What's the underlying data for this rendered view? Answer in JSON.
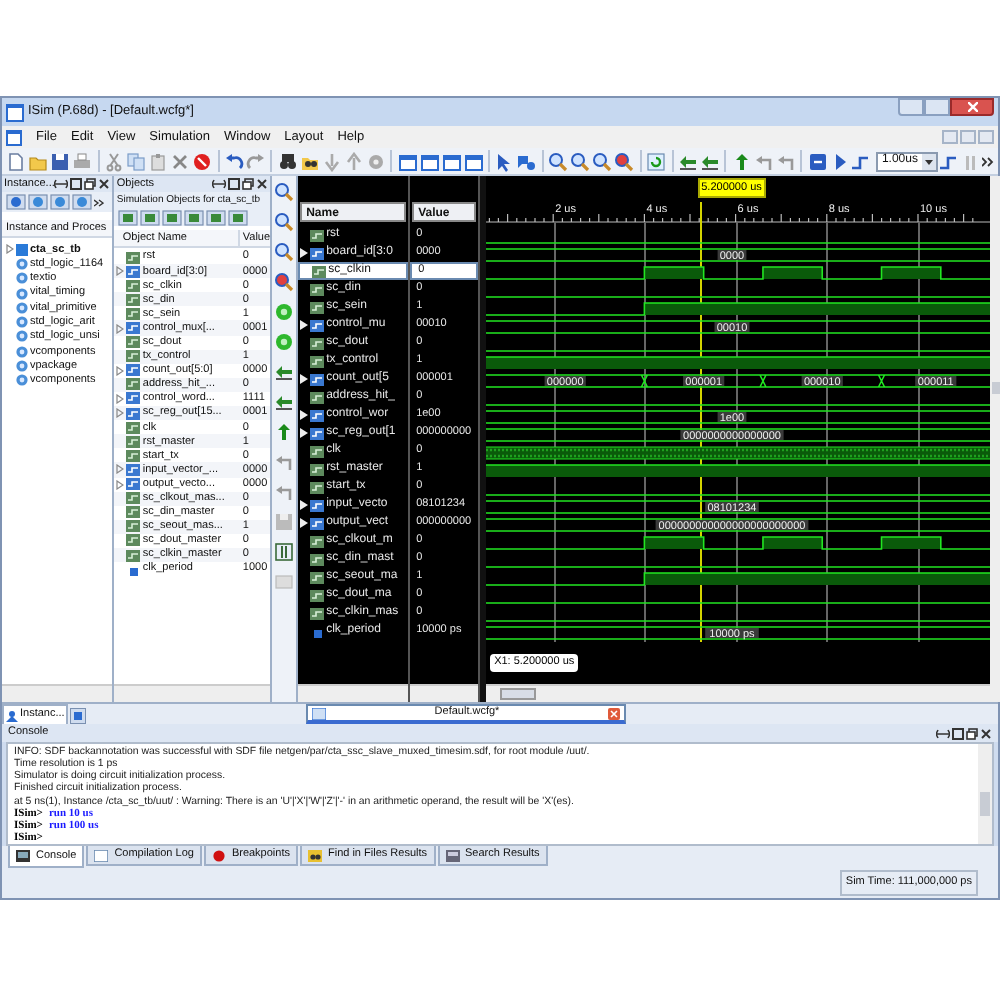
{
  "window": {
    "title": "ISim (P.68d) - [Default.wcfg*]"
  },
  "menu": [
    "File",
    "Edit",
    "View",
    "Simulation",
    "Window",
    "Layout",
    "Help"
  ],
  "toolbar": {
    "zoom_time": "1.00us"
  },
  "instances_panel": {
    "title": "Instance...",
    "column": "Instance and Proces",
    "items": [
      {
        "label": "cta_sc_tb",
        "kind": "module"
      },
      {
        "label": "std_logic_1164",
        "kind": "package"
      },
      {
        "label": "textio",
        "kind": "package"
      },
      {
        "label": "vital_timing",
        "kind": "package"
      },
      {
        "label": "vital_primitive",
        "kind": "package"
      },
      {
        "label": "std_logic_arit",
        "kind": "package"
      },
      {
        "label": "std_logic_unsi",
        "kind": "package"
      },
      {
        "label": "vcomponents",
        "kind": "package"
      },
      {
        "label": "vpackage",
        "kind": "package"
      },
      {
        "label": "vcomponents",
        "kind": "package"
      }
    ]
  },
  "objects_panel": {
    "title": "Objects",
    "subtitle": "Simulation Objects for cta_sc_tb",
    "columns": [
      "Object Name",
      "Value"
    ],
    "rows": [
      {
        "name": "rst",
        "value": "0",
        "kind": "bit"
      },
      {
        "name": "board_id[3:0]",
        "value": "0000",
        "kind": "bus"
      },
      {
        "name": "sc_clkin",
        "value": "0",
        "kind": "bit"
      },
      {
        "name": "sc_din",
        "value": "0",
        "kind": "bit"
      },
      {
        "name": "sc_sein",
        "value": "1",
        "kind": "bit"
      },
      {
        "name": "control_mux[...",
        "value": "0001",
        "kind": "bus"
      },
      {
        "name": "sc_dout",
        "value": "0",
        "kind": "bit"
      },
      {
        "name": "tx_control",
        "value": "1",
        "kind": "bit"
      },
      {
        "name": "count_out[5:0]",
        "value": "0000",
        "kind": "bus"
      },
      {
        "name": "address_hit_...",
        "value": "0",
        "kind": "bit"
      },
      {
        "name": "control_word...",
        "value": "1111",
        "kind": "bus"
      },
      {
        "name": "sc_reg_out[15...",
        "value": "0001",
        "kind": "bus"
      },
      {
        "name": "clk",
        "value": "0",
        "kind": "bit"
      },
      {
        "name": "rst_master",
        "value": "1",
        "kind": "bit"
      },
      {
        "name": "start_tx",
        "value": "0",
        "kind": "bit"
      },
      {
        "name": "input_vector_...",
        "value": "0000",
        "kind": "bus"
      },
      {
        "name": "output_vecto...",
        "value": "0000",
        "kind": "bus"
      },
      {
        "name": "sc_clkout_mas...",
        "value": "0",
        "kind": "bit"
      },
      {
        "name": "sc_din_master",
        "value": "0",
        "kind": "bit"
      },
      {
        "name": "sc_seout_mas...",
        "value": "1",
        "kind": "bit"
      },
      {
        "name": "sc_dout_master",
        "value": "0",
        "kind": "bit"
      },
      {
        "name": "sc_clkin_master",
        "value": "0",
        "kind": "bit"
      },
      {
        "name": "clk_period",
        "value": "1000",
        "kind": "const"
      }
    ]
  },
  "wave": {
    "columns": [
      "Name",
      "Value"
    ],
    "cursor_time": "5.200000 us",
    "cursor_readout": "X1: 5.200000 us",
    "time_ticks": [
      "2 us",
      "4 us",
      "6 us",
      "8 us",
      "10 us"
    ],
    "signals": [
      {
        "name": "rst",
        "value": "0",
        "kind": "bit",
        "selected": false,
        "wave": {
          "kind": "low"
        }
      },
      {
        "name": "board_id[3:0",
        "value": "0000",
        "kind": "bus",
        "selected": false,
        "wave": {
          "kind": "bus",
          "labels": [
            "0000"
          ]
        }
      },
      {
        "name": "sc_clkin",
        "value": "0",
        "kind": "bit",
        "selected": true,
        "wave": {
          "kind": "clock"
        }
      },
      {
        "name": "sc_din",
        "value": "0",
        "kind": "bit",
        "selected": false,
        "wave": {
          "kind": "low"
        }
      },
      {
        "name": "sc_sein",
        "value": "1",
        "kind": "bit",
        "selected": false,
        "wave": {
          "kind": "rise"
        }
      },
      {
        "name": "control_mu",
        "value": "00010",
        "kind": "bus",
        "selected": false,
        "wave": {
          "kind": "bus",
          "labels": [
            "00010"
          ]
        }
      },
      {
        "name": "sc_dout",
        "value": "0",
        "kind": "bit",
        "selected": false,
        "wave": {
          "kind": "low"
        }
      },
      {
        "name": "tx_control",
        "value": "1",
        "kind": "bit",
        "selected": false,
        "wave": {
          "kind": "high"
        }
      },
      {
        "name": "count_out[5",
        "value": "000001",
        "kind": "bus",
        "selected": false,
        "wave": {
          "kind": "bus",
          "labels": [
            "000000",
            "000001",
            "000010",
            "000011"
          ]
        }
      },
      {
        "name": "address_hit_",
        "value": "0",
        "kind": "bit",
        "selected": false,
        "wave": {
          "kind": "low"
        }
      },
      {
        "name": "control_wor",
        "value": "1e00",
        "kind": "bus",
        "selected": false,
        "wave": {
          "kind": "bus",
          "labels": [
            "1e00"
          ]
        }
      },
      {
        "name": "sc_reg_out[1",
        "value": "000000000",
        "kind": "bus",
        "selected": false,
        "wave": {
          "kind": "bus",
          "labels": [
            "0000000000000000"
          ]
        }
      },
      {
        "name": "clk",
        "value": "0",
        "kind": "bit",
        "selected": false,
        "wave": {
          "kind": "dense"
        }
      },
      {
        "name": "rst_master",
        "value": "1",
        "kind": "bit",
        "selected": false,
        "wave": {
          "kind": "high"
        }
      },
      {
        "name": "start_tx",
        "value": "0",
        "kind": "bit",
        "selected": false,
        "wave": {
          "kind": "low"
        }
      },
      {
        "name": "input_vecto",
        "value": "08101234",
        "kind": "bus",
        "selected": false,
        "wave": {
          "kind": "bus",
          "labels": [
            "08101234"
          ]
        }
      },
      {
        "name": "output_vect",
        "value": "000000000",
        "kind": "bus",
        "selected": false,
        "wave": {
          "kind": "bus",
          "labels": [
            "000000000000000000000000"
          ]
        }
      },
      {
        "name": "sc_clkout_m",
        "value": "0",
        "kind": "bit",
        "selected": false,
        "wave": {
          "kind": "clock"
        }
      },
      {
        "name": "sc_din_mast",
        "value": "0",
        "kind": "bit",
        "selected": false,
        "wave": {
          "kind": "low"
        }
      },
      {
        "name": "sc_seout_ma",
        "value": "1",
        "kind": "bit",
        "selected": false,
        "wave": {
          "kind": "rise"
        }
      },
      {
        "name": "sc_dout_ma",
        "value": "0",
        "kind": "bit",
        "selected": false,
        "wave": {
          "kind": "low"
        }
      },
      {
        "name": "sc_clkin_mas",
        "value": "0",
        "kind": "bit",
        "selected": false,
        "wave": {
          "kind": "low"
        }
      },
      {
        "name": "clk_period",
        "value": "10000 ps",
        "kind": "const",
        "selected": false,
        "wave": {
          "kind": "bus",
          "labels": [
            "10000 ps"
          ]
        }
      }
    ]
  },
  "left_tabs": [
    {
      "label": "Instanc...",
      "selected": true
    }
  ],
  "document_tabs": [
    {
      "label": "Default.wcfg*",
      "selected": true
    }
  ],
  "console": {
    "title": "Console",
    "lines": [
      {
        "kind": "output",
        "text": "INFO: SDF backannotation was successful with SDF file netgen/par/cta_ssc_slave_muxed_timesim.sdf, for root module /uut/."
      },
      {
        "kind": "output",
        "text": "Time resolution is 1 ps"
      },
      {
        "kind": "output",
        "text": "Simulator is doing circuit initialization process."
      },
      {
        "kind": "output",
        "text": "Finished circuit initialization process."
      },
      {
        "kind": "output",
        "text": "at 5 ns(1), Instance /cta_sc_tb/uut/ : Warning: There is an 'U'|'X'|'W'|'Z'|'-' in an arithmetic operand, the result will be 'X'(es)."
      },
      {
        "kind": "command",
        "prompt": "ISim>",
        "text": "run 10 us"
      },
      {
        "kind": "command",
        "prompt": "ISim>",
        "text": "run 100 us"
      },
      {
        "kind": "command",
        "prompt": "ISim>"
      }
    ],
    "tabs": [
      {
        "label": "Console",
        "selected": true
      },
      {
        "label": "Compilation Log",
        "selected": false
      },
      {
        "label": "Breakpoints",
        "selected": false
      },
      {
        "label": "Find in Files Results",
        "selected": false
      },
      {
        "label": "Search Results",
        "selected": false
      }
    ]
  },
  "status_bar": {
    "sim_time": "Sim Time: 111,000,000 ps"
  }
}
